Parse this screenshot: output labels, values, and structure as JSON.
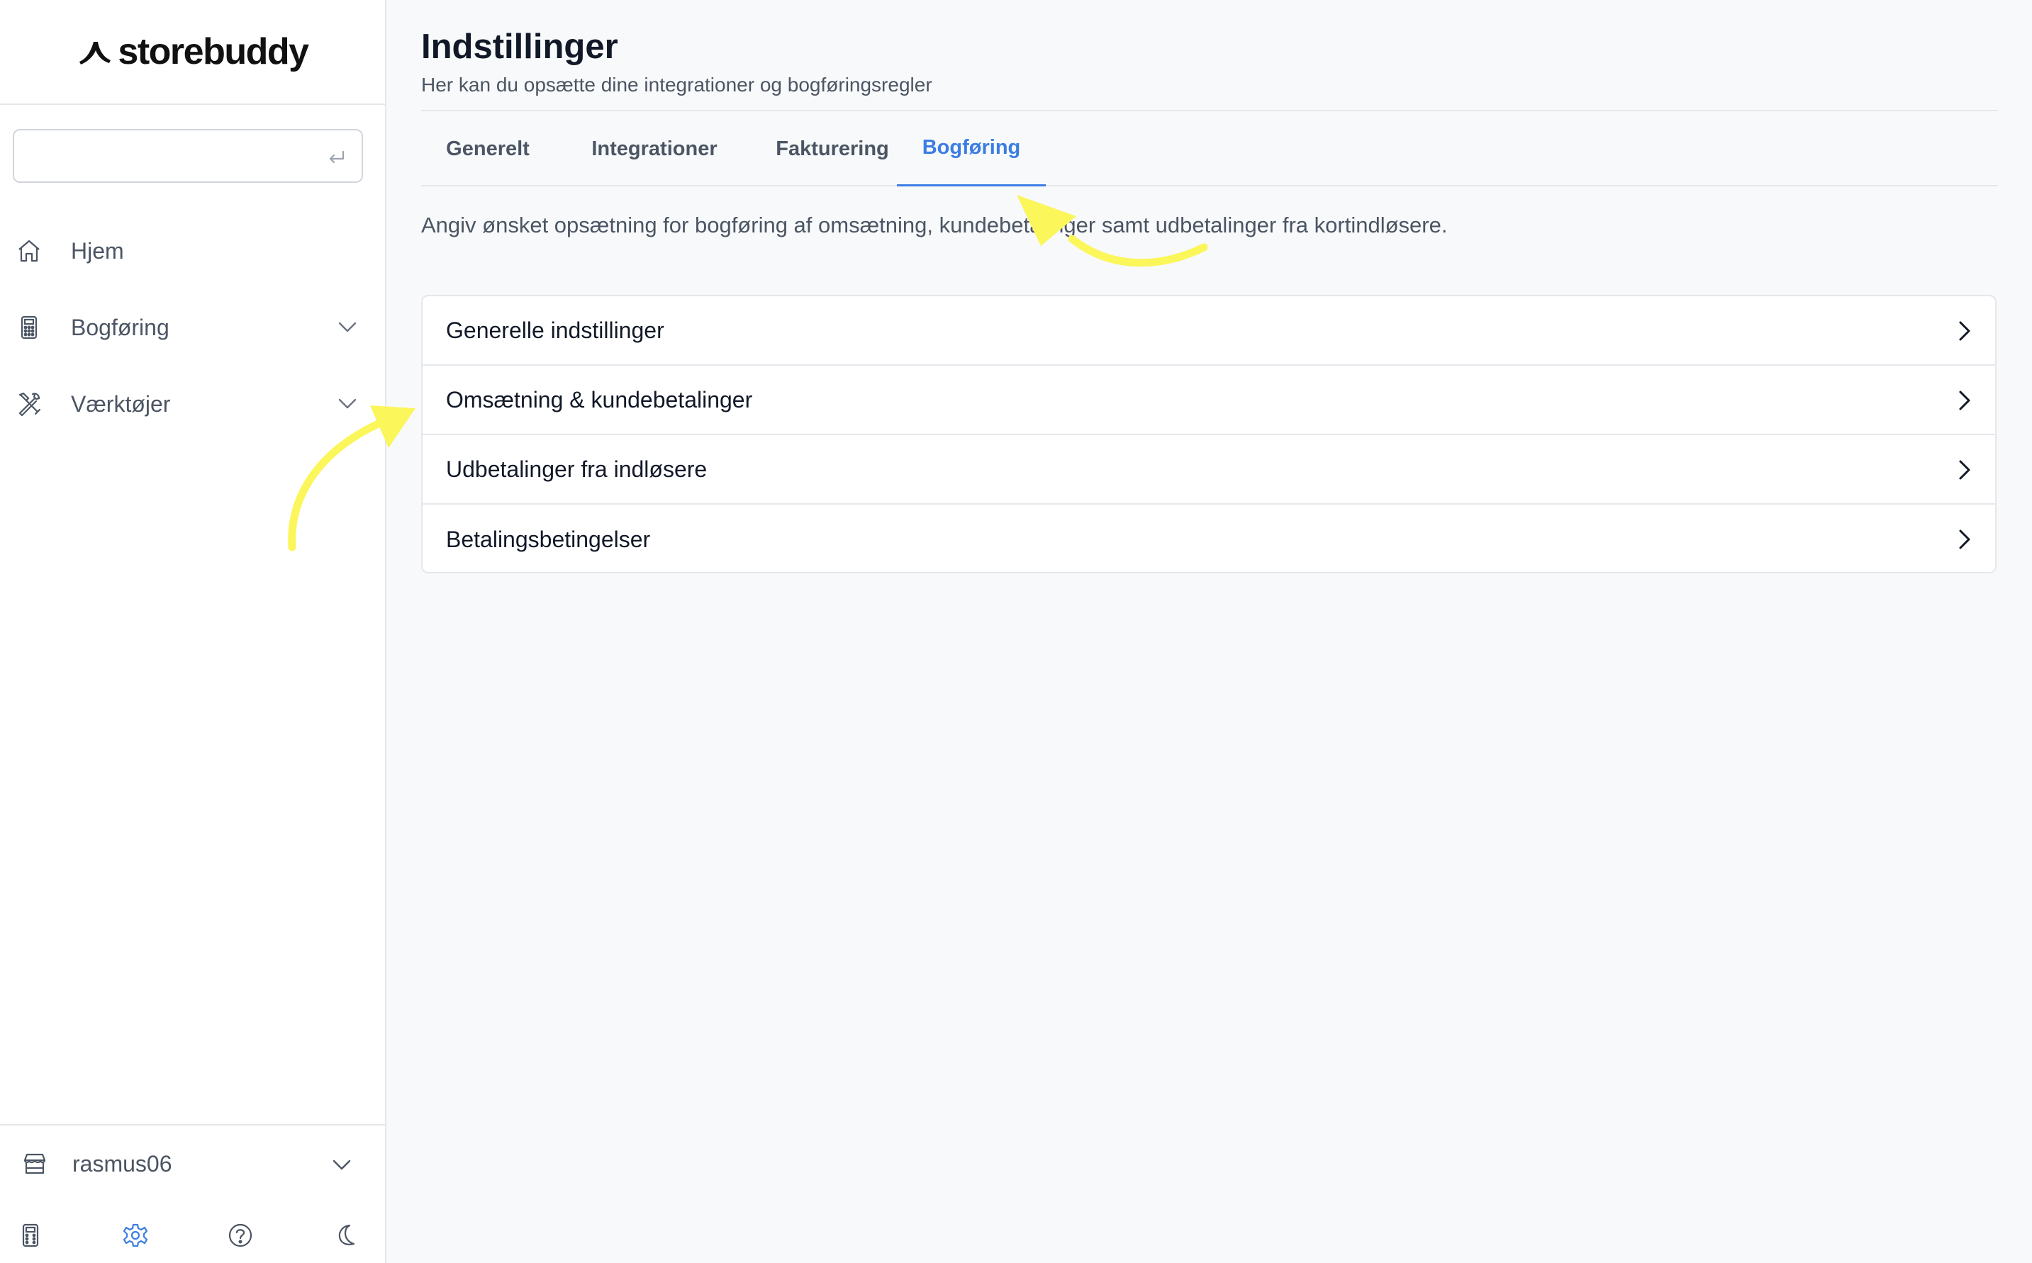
{
  "brand": {
    "name": "storebuddy"
  },
  "search": {
    "placeholder": "",
    "value": "",
    "enter_icon": "enter-return-icon"
  },
  "sidebar": {
    "items": [
      {
        "label": "Hjem",
        "icon": "home-icon",
        "expandable": false
      },
      {
        "label": "Bogføring",
        "icon": "calculator-icon",
        "expandable": true
      },
      {
        "label": "Værktøjer",
        "icon": "tools-icon",
        "expandable": true
      }
    ],
    "store": {
      "label": "rasmus06",
      "icon": "store-icon"
    },
    "bottom_icons": [
      "calculator-icon",
      "settings-gear-icon",
      "help-question-icon",
      "dark-mode-moon-icon"
    ]
  },
  "page": {
    "title": "Indstillinger",
    "subtitle": "Her kan du opsætte dine integrationer og bogføringsregler"
  },
  "tabs": [
    {
      "label": "Generelt",
      "active": false
    },
    {
      "label": "Integrationer",
      "active": false
    },
    {
      "label": "Fakturering",
      "active": false
    },
    {
      "label": "Bogføring",
      "active": true
    }
  ],
  "intro": "Angiv ønsket opsætning for bogføring af omsætning, kundebetalinger samt udbetalinger fra kortindløsere.",
  "settings_rows": [
    {
      "label": "Generelle indstillinger"
    },
    {
      "label": "Omsætning & kundebetalinger"
    },
    {
      "label": "Udbetalinger fra indløsere"
    },
    {
      "label": "Betalingsbetingelser"
    }
  ],
  "colors": {
    "accent": "#3b7de3",
    "annotation": "#fbf65a",
    "text_muted": "#4b5563",
    "border": "#e5e7eb"
  }
}
